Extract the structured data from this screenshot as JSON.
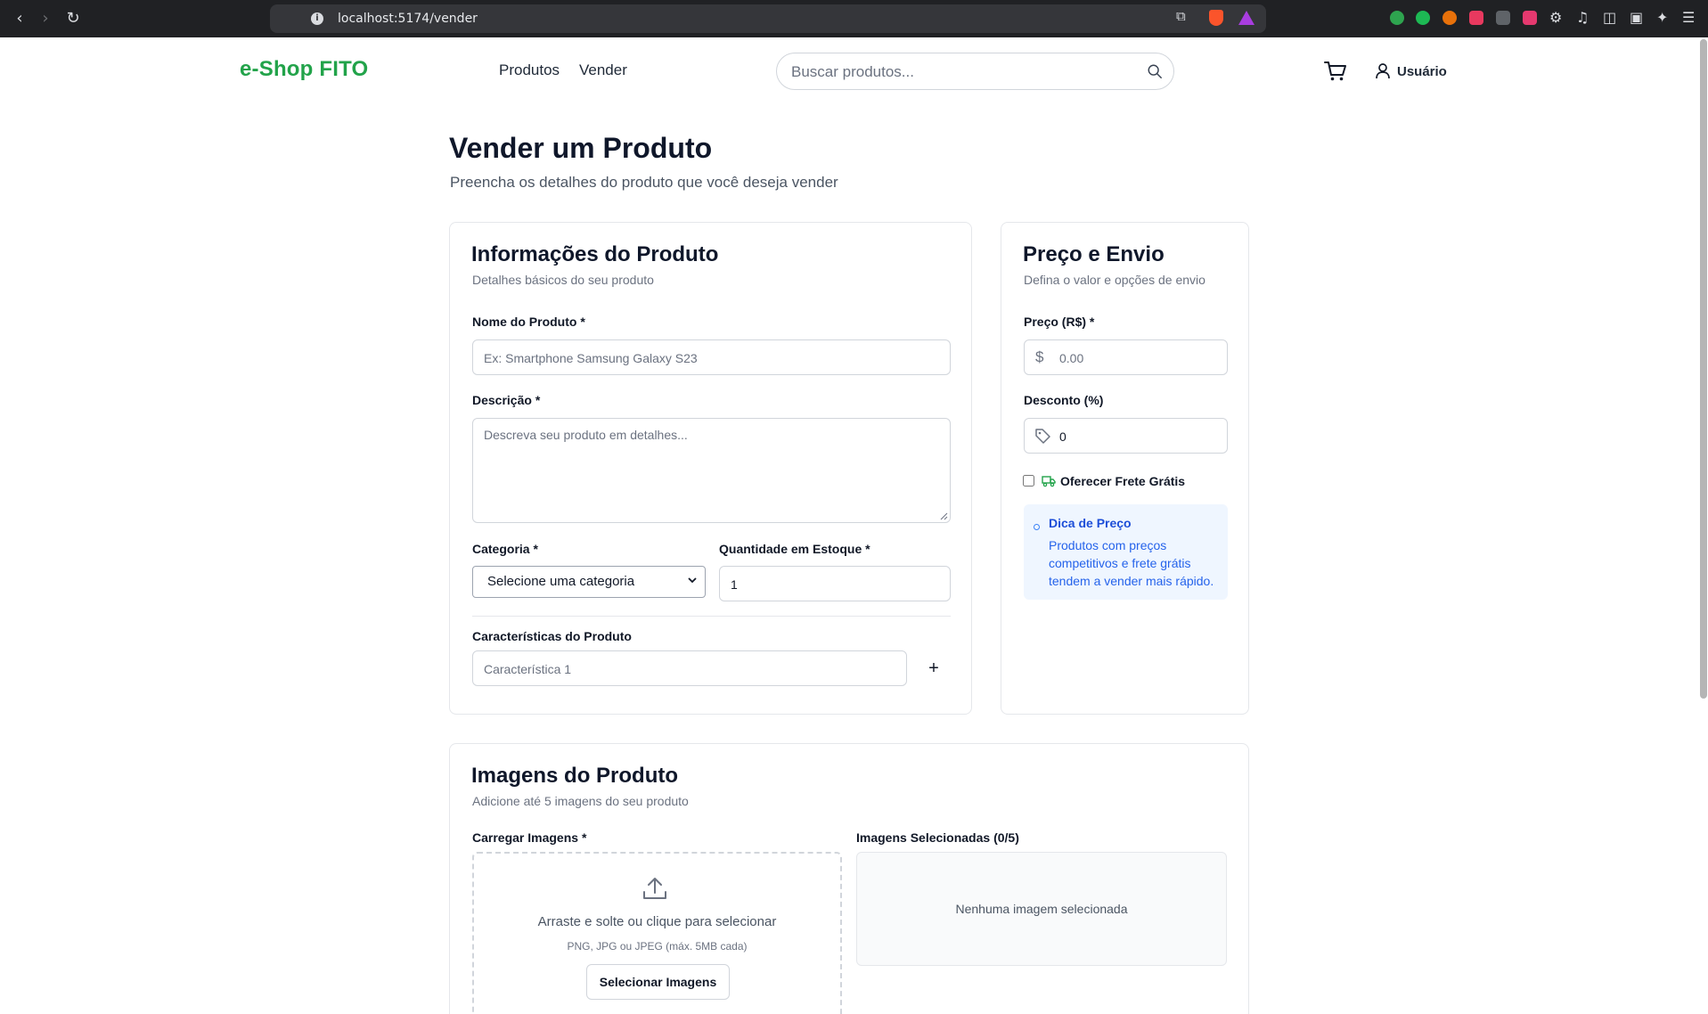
{
  "browser": {
    "url": "localhost:5174/vender"
  },
  "header": {
    "logo": "e-Shop FITO",
    "nav": [
      "Produtos",
      "Vender"
    ],
    "search_placeholder": "Buscar produtos...",
    "user_label": "Usuário"
  },
  "page": {
    "title": "Vender um Produto",
    "subtitle": "Preencha os detalhes do produto que você deseja vender"
  },
  "product_info": {
    "title": "Informações do Produto",
    "subtitle": "Detalhes básicos do seu produto",
    "name_label": "Nome do Produto *",
    "name_placeholder": "Ex: Smartphone Samsung Galaxy S23",
    "description_label": "Descrição *",
    "description_placeholder": "Descreva seu produto em detalhes...",
    "category_label": "Categoria *",
    "category_value": "Selecione uma categoria",
    "stock_label": "Quantidade em Estoque *",
    "stock_value": "1",
    "features_label": "Características do Produto",
    "feature_placeholder": "Característica 1",
    "add_feature": "+"
  },
  "pricing": {
    "title": "Preço e Envio",
    "subtitle": "Defina o valor e opções de envio",
    "price_label": "Preço (R$) *",
    "price_placeholder": "0.00",
    "discount_label": "Desconto (%)",
    "discount_value": "0",
    "free_shipping_label": "Oferecer Frete Grátis",
    "free_shipping_checked": false,
    "tip_title": "Dica de Preço",
    "tip_text": "Produtos com preços competitivos e frete grátis tendem a vender mais rápido."
  },
  "images": {
    "title": "Imagens do Produto",
    "subtitle": "Adicione até 5 imagens do seu produto",
    "upload_label": "Carregar Imagens *",
    "dropzone_text": "Arraste e solte ou clique para selecionar",
    "dropzone_hint": "PNG, JPG ou JPEG (máx. 5MB cada)",
    "select_button": "Selecionar Imagens",
    "selected_label": "Imagens Selecionadas (0/5)",
    "empty_text": "Nenhuma imagem selecionada"
  },
  "colors": {
    "brand": "#22a34a",
    "tip_bg": "#eff6ff",
    "tip_text": "#2563eb"
  }
}
